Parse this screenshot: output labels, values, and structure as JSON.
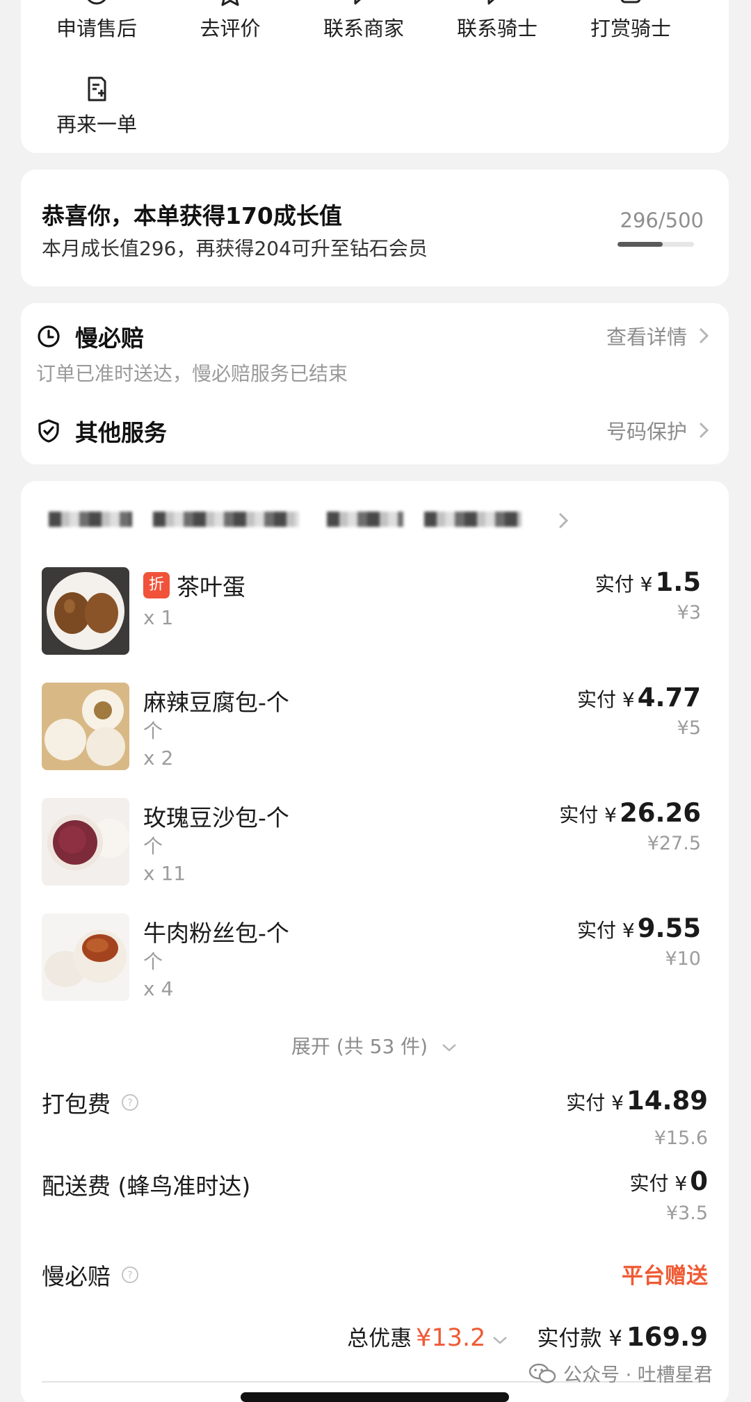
{
  "actions": [
    {
      "label": "申请售后",
      "icon": "after-sales-icon"
    },
    {
      "label": "去评价",
      "icon": "star-icon"
    },
    {
      "label": "联系商家",
      "icon": "chat-icon"
    },
    {
      "label": "联系骑士",
      "icon": "chat-icon"
    },
    {
      "label": "打赏骑士",
      "icon": "reward-icon"
    },
    {
      "label": "再来一单",
      "icon": "reorder-icon"
    }
  ],
  "growth": {
    "title": "恭喜你，本单获得170成长值",
    "subtitle": "本月成长值296，再获得204可升至钻石会员",
    "progress_text": "296/500",
    "progress_fraction": 0.592
  },
  "service": {
    "slow_pay_title": "慢必赔",
    "slow_pay_link": "查看详情",
    "slow_pay_note": "订单已准时送达，慢必赔服务已结束",
    "other_title": "其他服务",
    "other_link": "号码保护"
  },
  "items": [
    {
      "name": "茶叶蛋",
      "discount_tag": "折",
      "spec": "",
      "qty": "x 1",
      "pay_label": "实付 ¥",
      "pay": "1.5",
      "orig": "¥3"
    },
    {
      "name": "麻辣豆腐包-个",
      "spec": "个",
      "qty": "x 2",
      "pay_label": "实付 ¥",
      "pay": "4.77",
      "orig": "¥5"
    },
    {
      "name": "玫瑰豆沙包-个",
      "spec": "个",
      "qty": "x 11",
      "pay_label": "实付 ¥",
      "pay": "26.26",
      "orig": "¥27.5"
    },
    {
      "name": "牛肉粉丝包-个",
      "spec": "个",
      "qty": "x 4",
      "pay_label": "实付 ¥",
      "pay": "9.55",
      "orig": "¥10"
    }
  ],
  "expand_label": "展开 (共 53 件)",
  "fees": {
    "packing_label": "打包费",
    "packing_pay_label": "实付 ¥",
    "packing_pay": "14.89",
    "packing_orig": "¥15.6",
    "delivery_label": "配送费 (蜂鸟准时达)",
    "delivery_pay_label": "实付 ¥",
    "delivery_pay": "0",
    "delivery_orig": "¥3.5",
    "slow_pay_label": "慢必赔",
    "slow_pay_value": "平台赠送"
  },
  "totals": {
    "discount_label": "总优惠",
    "discount_amount": "¥13.2",
    "pay_label": "实付款 ¥",
    "pay_amount": "169.9"
  },
  "watermark": "公众号 · 吐槽星君",
  "colors": {
    "accent_red": "#ef5a34",
    "discount_tag": "#f0533a",
    "background": "#f2f2f2"
  }
}
